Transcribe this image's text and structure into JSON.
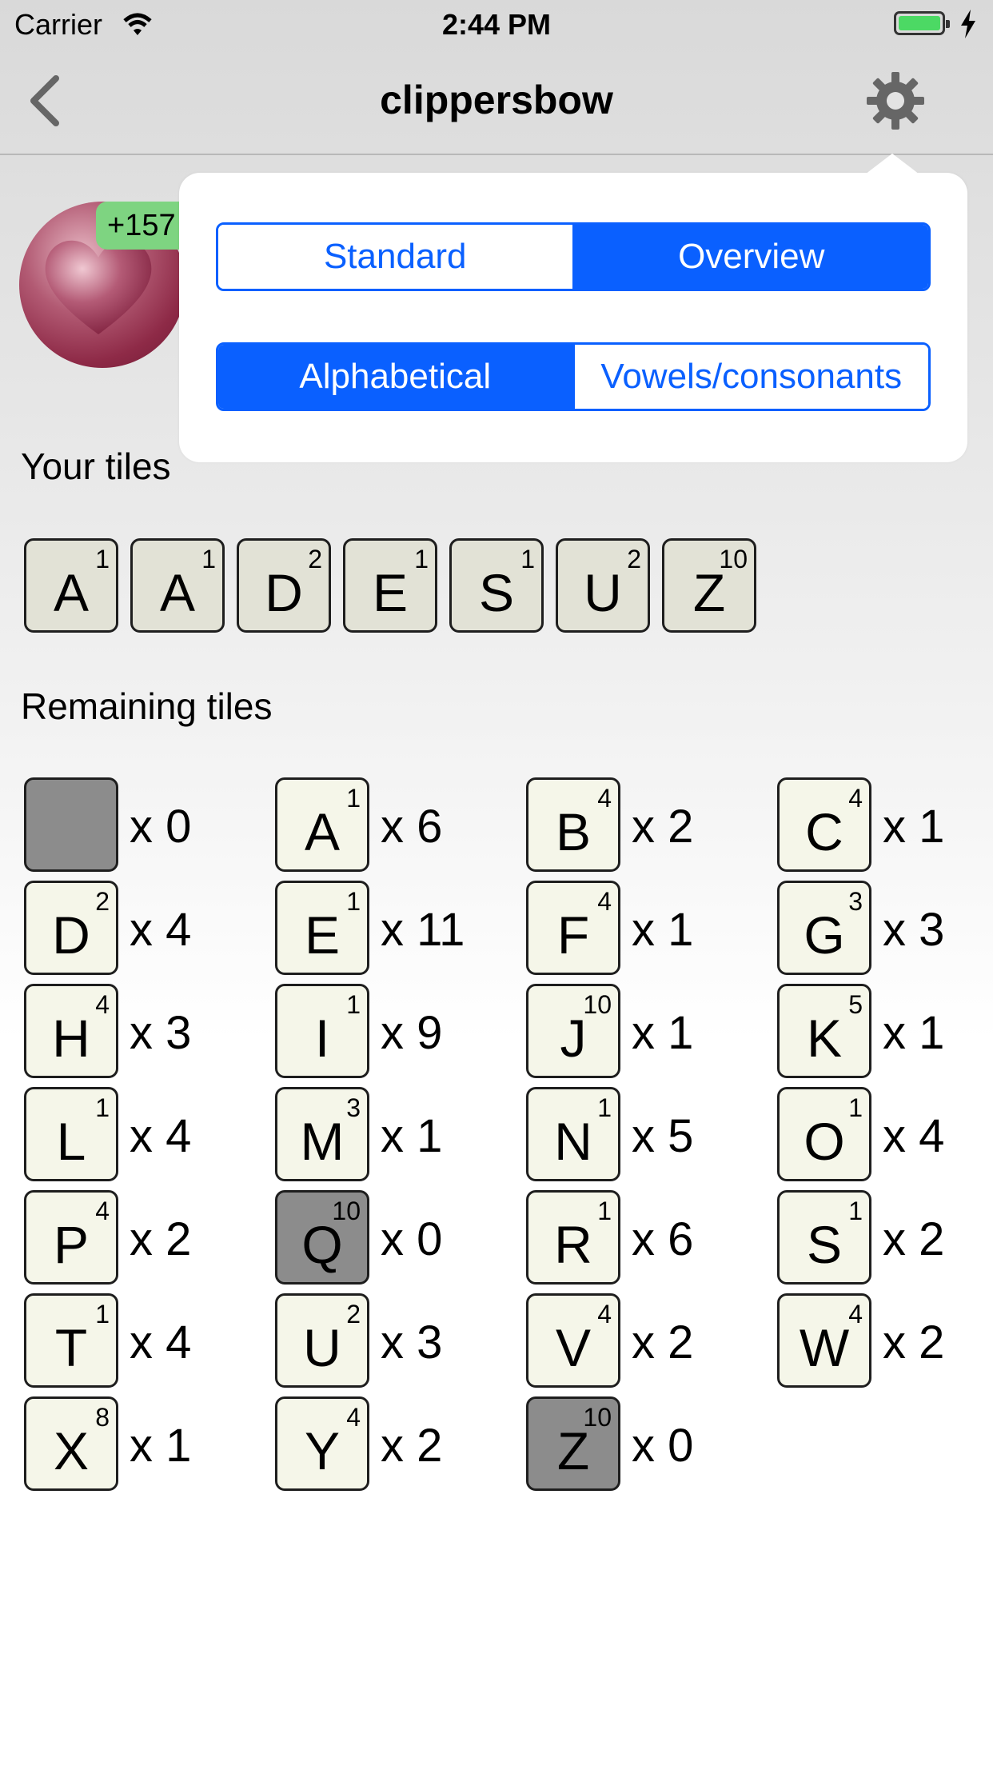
{
  "status_bar": {
    "carrier": "Carrier",
    "time": "2:44 PM"
  },
  "nav": {
    "title": "clippersbow",
    "back_icon": "chevron-left-icon",
    "settings_icon": "gear-icon"
  },
  "player": {
    "score_delta": "+157"
  },
  "popover": {
    "view_options": [
      {
        "label": "Standard",
        "selected": false
      },
      {
        "label": "Overview",
        "selected": true
      }
    ],
    "sort_options": [
      {
        "label": "Alphabetical",
        "selected": true
      },
      {
        "label": "Vowels/consonants",
        "selected": false
      }
    ]
  },
  "your_tiles": {
    "heading": "Your tiles",
    "tiles": [
      {
        "letter": "A",
        "value": "1"
      },
      {
        "letter": "A",
        "value": "1"
      },
      {
        "letter": "D",
        "value": "2"
      },
      {
        "letter": "E",
        "value": "1"
      },
      {
        "letter": "S",
        "value": "1"
      },
      {
        "letter": "U",
        "value": "2"
      },
      {
        "letter": "Z",
        "value": "10"
      }
    ]
  },
  "remaining_tiles": {
    "heading": "Remaining tiles",
    "tiles": [
      {
        "letter": "",
        "value": "",
        "count": "x 0",
        "depleted": true
      },
      {
        "letter": "A",
        "value": "1",
        "count": "x 6",
        "depleted": false
      },
      {
        "letter": "B",
        "value": "4",
        "count": "x 2",
        "depleted": false
      },
      {
        "letter": "C",
        "value": "4",
        "count": "x 1",
        "depleted": false
      },
      {
        "letter": "D",
        "value": "2",
        "count": "x 4",
        "depleted": false
      },
      {
        "letter": "E",
        "value": "1",
        "count": "x 11",
        "depleted": false
      },
      {
        "letter": "F",
        "value": "4",
        "count": "x 1",
        "depleted": false
      },
      {
        "letter": "G",
        "value": "3",
        "count": "x 3",
        "depleted": false
      },
      {
        "letter": "H",
        "value": "4",
        "count": "x 3",
        "depleted": false
      },
      {
        "letter": "I",
        "value": "1",
        "count": "x 9",
        "depleted": false
      },
      {
        "letter": "J",
        "value": "10",
        "count": "x 1",
        "depleted": false
      },
      {
        "letter": "K",
        "value": "5",
        "count": "x 1",
        "depleted": false
      },
      {
        "letter": "L",
        "value": "1",
        "count": "x 4",
        "depleted": false
      },
      {
        "letter": "M",
        "value": "3",
        "count": "x 1",
        "depleted": false
      },
      {
        "letter": "N",
        "value": "1",
        "count": "x 5",
        "depleted": false
      },
      {
        "letter": "O",
        "value": "1",
        "count": "x 4",
        "depleted": false
      },
      {
        "letter": "P",
        "value": "4",
        "count": "x 2",
        "depleted": false
      },
      {
        "letter": "Q",
        "value": "10",
        "count": "x 0",
        "depleted": true
      },
      {
        "letter": "R",
        "value": "1",
        "count": "x 6",
        "depleted": false
      },
      {
        "letter": "S",
        "value": "1",
        "count": "x 2",
        "depleted": false
      },
      {
        "letter": "T",
        "value": "1",
        "count": "x 4",
        "depleted": false
      },
      {
        "letter": "U",
        "value": "2",
        "count": "x 3",
        "depleted": false
      },
      {
        "letter": "V",
        "value": "4",
        "count": "x 2",
        "depleted": false
      },
      {
        "letter": "W",
        "value": "4",
        "count": "x 2",
        "depleted": false
      },
      {
        "letter": "X",
        "value": "8",
        "count": "x 1",
        "depleted": false
      },
      {
        "letter": "Y",
        "value": "4",
        "count": "x 2",
        "depleted": false
      },
      {
        "letter": "Z",
        "value": "10",
        "count": "x 0",
        "depleted": true
      }
    ]
  },
  "colors": {
    "accent": "#0a60ff",
    "tile_face": "#f5f6e9",
    "tile_depleted": "#8c8c8c",
    "badge": "#7ed481",
    "battery": "#4cd964"
  }
}
